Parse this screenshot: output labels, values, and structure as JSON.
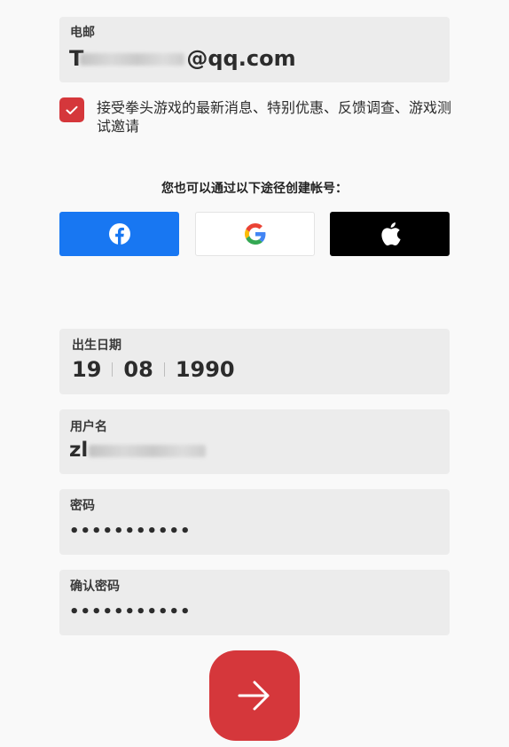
{
  "email": {
    "label": "电邮",
    "value_prefix": "T",
    "value_suffix": "@qq.com"
  },
  "consent": {
    "checked": true,
    "text": "接受拳头游戏的最新消息、特别优惠、反馈调查、游戏测试邀请"
  },
  "social": {
    "heading": "您也可以通过以下途径创建帐号：",
    "buttons": [
      {
        "provider": "facebook",
        "icon": "facebook-icon",
        "color": "#1877f2"
      },
      {
        "provider": "google",
        "icon": "google-icon",
        "color": "#ffffff"
      },
      {
        "provider": "apple",
        "icon": "apple-icon",
        "color": "#000000"
      }
    ]
  },
  "dob": {
    "label": "出生日期",
    "day": "19",
    "month": "08",
    "year": "1990"
  },
  "username": {
    "label": "用户名",
    "value_prefix": "zl"
  },
  "password": {
    "label": "密码",
    "value": "•••••••••••"
  },
  "confirm_password": {
    "label": "确认密码",
    "value": "•••••••••••"
  },
  "submit": {
    "icon": "arrow-right-icon",
    "color": "#d5373b"
  }
}
